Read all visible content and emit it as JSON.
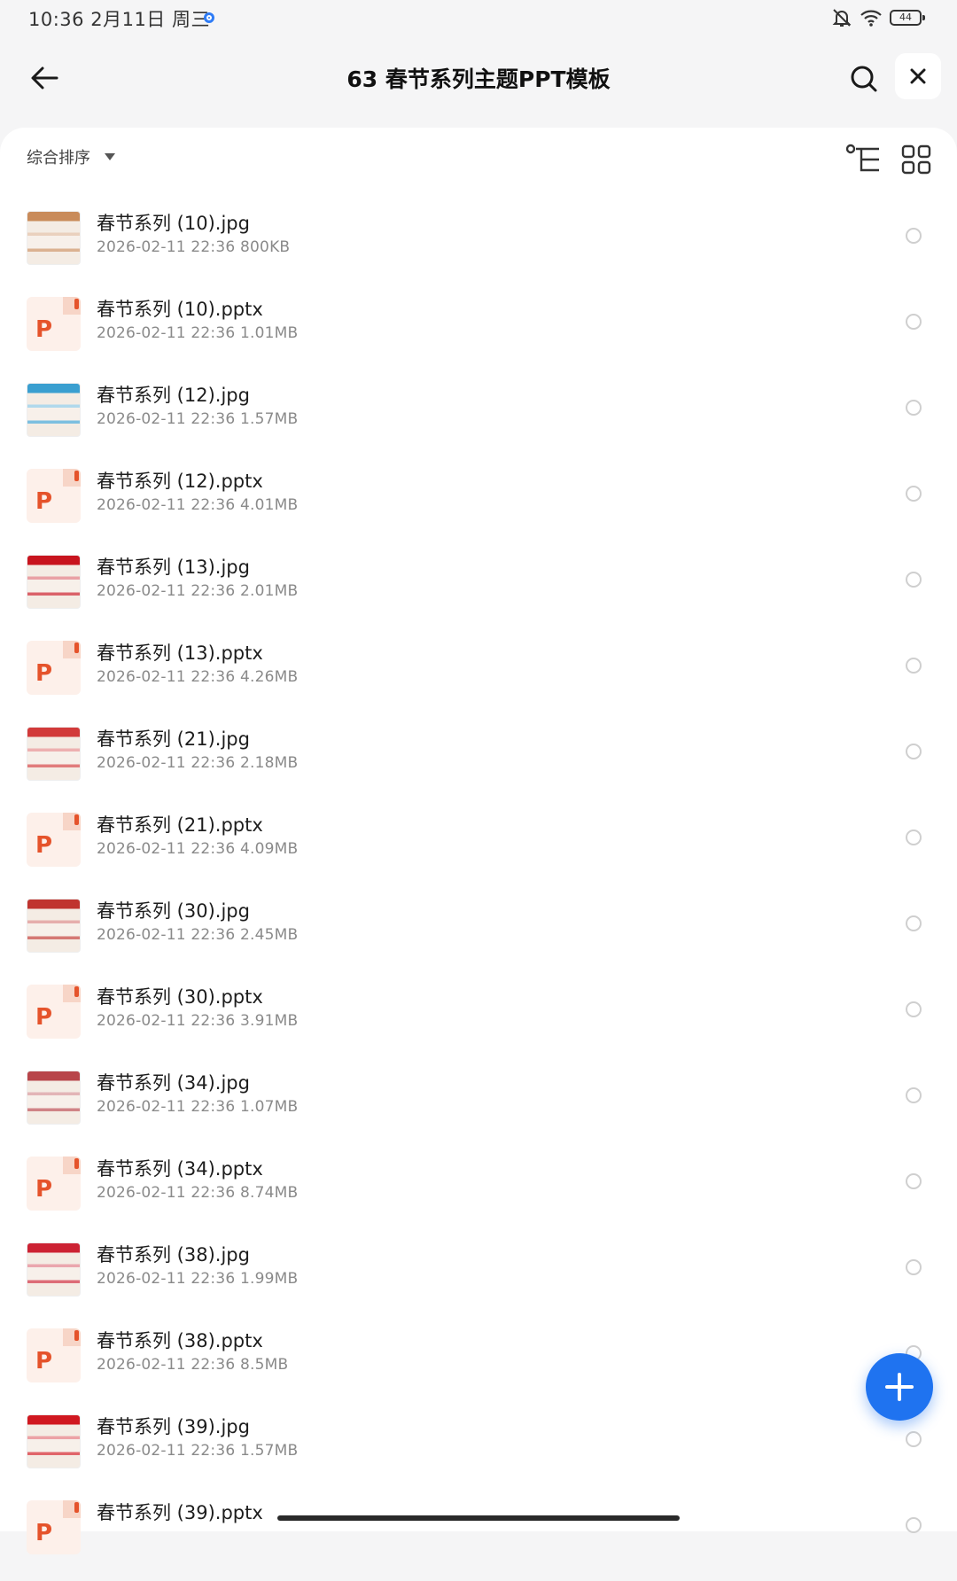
{
  "status_bar": {
    "time": "10:36",
    "date": "2月11日 周三",
    "battery": "44"
  },
  "header": {
    "title": "63 春节系列主题PPT模板"
  },
  "sort": {
    "label": "综合排序"
  },
  "colors": {
    "accent": "#1f73f0",
    "pptx_orange": "#e5532b",
    "festive_red": "#c8141e"
  },
  "files": [
    {
      "name": "春节系列 (10).jpg",
      "date": "2026-02-11 22:36",
      "size": "800KB",
      "type": "jpg",
      "thumb_color": "#c98b5a"
    },
    {
      "name": "春节系列 (10).pptx",
      "date": "2026-02-11 22:36",
      "size": "1.01MB",
      "type": "pptx"
    },
    {
      "name": "春节系列 (12).jpg",
      "date": "2026-02-11 22:36",
      "size": "1.57MB",
      "type": "jpg",
      "thumb_color": "#3a9fd0"
    },
    {
      "name": "春节系列 (12).pptx",
      "date": "2026-02-11 22:36",
      "size": "4.01MB",
      "type": "pptx"
    },
    {
      "name": "春节系列 (13).jpg",
      "date": "2026-02-11 22:36",
      "size": "2.01MB",
      "type": "jpg",
      "thumb_color": "#c8141e"
    },
    {
      "name": "春节系列 (13).pptx",
      "date": "2026-02-11 22:36",
      "size": "4.26MB",
      "type": "pptx"
    },
    {
      "name": "春节系列 (21).jpg",
      "date": "2026-02-11 22:36",
      "size": "2.18MB",
      "type": "jpg",
      "thumb_color": "#d23a3a"
    },
    {
      "name": "春节系列 (21).pptx",
      "date": "2026-02-11 22:36",
      "size": "4.09MB",
      "type": "pptx"
    },
    {
      "name": "春节系列 (30).jpg",
      "date": "2026-02-11 22:36",
      "size": "2.45MB",
      "type": "jpg",
      "thumb_color": "#c0342f"
    },
    {
      "name": "春节系列 (30).pptx",
      "date": "2026-02-11 22:36",
      "size": "3.91MB",
      "type": "pptx"
    },
    {
      "name": "春节系列 (34).jpg",
      "date": "2026-02-11 22:36",
      "size": "1.07MB",
      "type": "jpg",
      "thumb_color": "#b8454a"
    },
    {
      "name": "春节系列 (34).pptx",
      "date": "2026-02-11 22:36",
      "size": "8.74MB",
      "type": "pptx"
    },
    {
      "name": "春节系列 (38).jpg",
      "date": "2026-02-11 22:36",
      "size": "1.99MB",
      "type": "jpg",
      "thumb_color": "#cc2233"
    },
    {
      "name": "春节系列 (38).pptx",
      "date": "2026-02-11 22:36",
      "size": "8.5MB",
      "type": "pptx"
    },
    {
      "name": "春节系列 (39).jpg",
      "date": "2026-02-11 22:36",
      "size": "1.57MB",
      "type": "jpg",
      "thumb_color": "#d01820"
    },
    {
      "name": "春节系列 (39).pptx",
      "date": "",
      "size": "",
      "type": "pptx"
    }
  ]
}
